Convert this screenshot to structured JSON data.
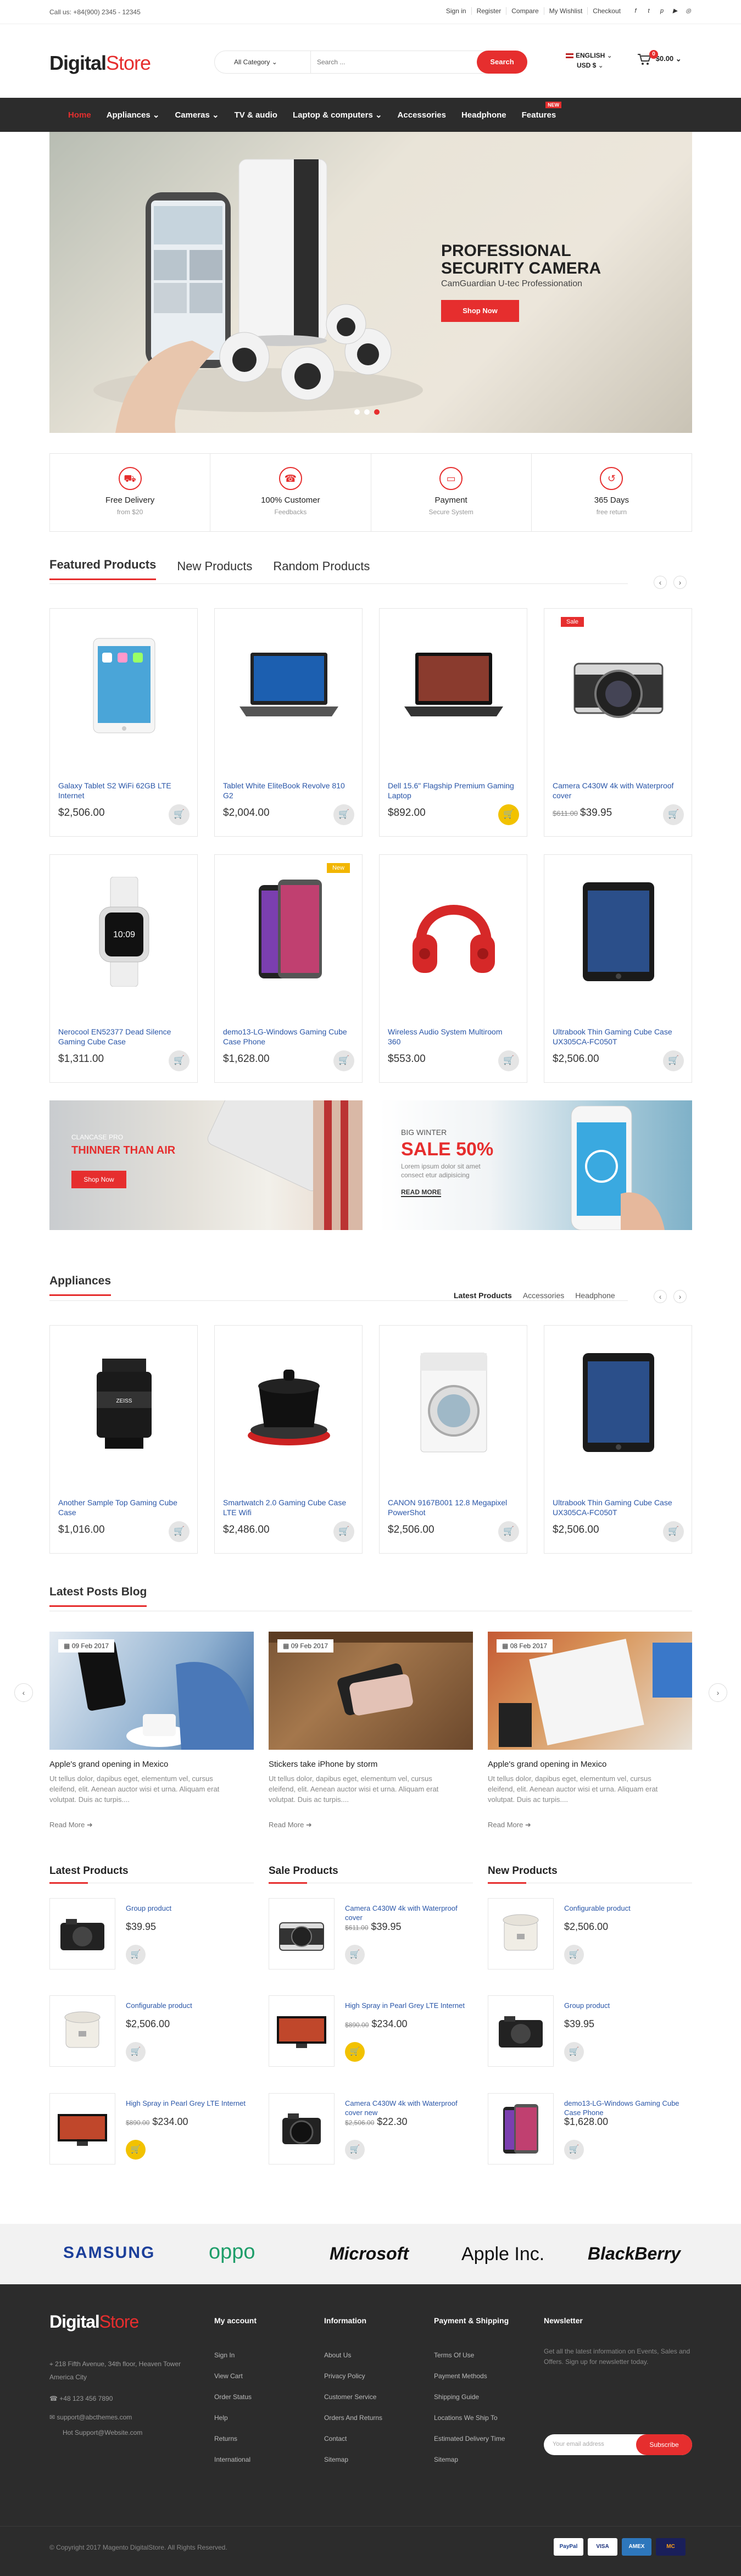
{
  "topbar": {
    "call": "Call us: +84(900) 2345 - 12345",
    "links": [
      "Sign in",
      "Register",
      "Compare",
      "My Wishlist",
      "Checkout"
    ],
    "social": [
      "f",
      "t",
      "p",
      "▶",
      "◎"
    ]
  },
  "header": {
    "logo_main": "Digital",
    "logo_accent": "Store",
    "search_category": "All Category",
    "search_placeholder": "Search ...",
    "search_button": "Search",
    "language": "ENGLISH",
    "currency": "USD $",
    "cart_count": "0",
    "cart_total": "$0.00"
  },
  "nav": {
    "items": [
      "Home",
      "Appliances",
      "Cameras",
      "TV & audio",
      "Laptop & computers",
      "Accessories",
      "Headphone",
      "Features"
    ],
    "new_badge": "NEW"
  },
  "hero": {
    "title": "PROFESSIONAL SECURITY CAMERA",
    "subtitle": "CamGuardian U-tec Professionation",
    "button": "Shop Now"
  },
  "features": [
    {
      "icon": "truck-icon",
      "title": "Free Delivery",
      "sub": "from $20"
    },
    {
      "icon": "support-icon",
      "title": "100% Customer",
      "sub": "Feedbacks"
    },
    {
      "icon": "payment-icon",
      "title": "Payment",
      "sub": "Secure System"
    },
    {
      "icon": "return-icon",
      "title": "365 Days",
      "sub": "free return"
    }
  ],
  "featured": {
    "tabs": [
      "Featured Products",
      "New Products",
      "Random Products"
    ],
    "products": [
      {
        "name": "Galaxy Tablet S2 WiFi 62GB LTE Internet",
        "price": "$2,506.00",
        "old": ""
      },
      {
        "name": "Tablet White EliteBook Revolve 810 G2",
        "price": "$2,004.00",
        "old": ""
      },
      {
        "name": "Dell 15.6\" Flagship Premium Gaming Laptop",
        "price": "$892.00",
        "old": ""
      },
      {
        "name": "Camera C430W 4k with Waterproof cover",
        "price": "$39.95",
        "old": "$611.00"
      },
      {
        "name": "Nerocool EN52377 Dead Silence Gaming Cube Case",
        "price": "$1,311.00",
        "old": ""
      },
      {
        "name": "demo13-LG-Windows Gaming Cube Case Phone",
        "price": "$1,628.00",
        "old": ""
      },
      {
        "name": "Wireless Audio System Multiroom 360",
        "price": "$553.00",
        "old": ""
      },
      {
        "name": "Ultrabook Thin Gaming Cube Case UX305CA-FC050T",
        "price": "$2,506.00",
        "old": ""
      }
    ],
    "sale_label": "Sale",
    "new_label": "New"
  },
  "banners": {
    "b1_small": "CLANCASE PRO",
    "b1_title": "THINNER THAN AIR",
    "b1_button": "Shop Now",
    "b2_small": "BIG WINTER",
    "b2_title": "SALE 50%",
    "b2_text": "Lorem ipsum dolor sit amet consect etur adipisicing",
    "b2_link": "READ MORE"
  },
  "appliances": {
    "title": "Appliances",
    "tabs": [
      "Latest Products",
      "Accessories",
      "Headphone"
    ],
    "products": [
      {
        "name": "Another Sample Top Gaming Cube Case",
        "price": "$1,016.00"
      },
      {
        "name": "Smartwatch 2.0 Gaming Cube Case LTE Wifi",
        "price": "$2,486.00"
      },
      {
        "name": "CANON 9167B001 12.8 Megapixel PowerShot",
        "price": "$2,506.00"
      },
      {
        "name": "Ultrabook Thin Gaming Cube Case UX305CA-FC050T",
        "price": "$2,506.00"
      }
    ]
  },
  "blog": {
    "title": "Latest Posts Blog",
    "read_more": "Read More",
    "posts": [
      {
        "date": "09 Feb 2017",
        "title": "Apple's grand opening in Mexico",
        "body": "Ut tellus dolor, dapibus eget, elementum vel, cursus eleifend, elit. Aenean auctor wisi et urna. Aliquam erat volutpat. Duis ac turpis...."
      },
      {
        "date": "09 Feb 2017",
        "title": "Stickers take iPhone by storm",
        "body": "Ut tellus dolor, dapibus eget, elementum vel, cursus eleifend, elit. Aenean auctor wisi et urna. Aliquam erat volutpat. Duis ac turpis...."
      },
      {
        "date": "08 Feb 2017",
        "title": "Apple's grand opening in Mexico",
        "body": "Ut tellus dolor, dapibus eget, elementum vel, cursus eleifend, elit. Aenean auctor wisi et urna. Aliquam erat volutpat. Duis ac turpis...."
      }
    ]
  },
  "lists": [
    {
      "title": "Latest Products",
      "items": [
        {
          "name": "Group product",
          "price": "$39.95",
          "old": ""
        },
        {
          "name": "Configurable product",
          "price": "$2,506.00",
          "old": ""
        },
        {
          "name": "High Spray in Pearl Grey LTE Internet",
          "price": "$234.00",
          "old": "$890.00"
        }
      ]
    },
    {
      "title": "Sale Products",
      "items": [
        {
          "name": "Camera C430W 4k with Waterproof cover",
          "price": "$39.95",
          "old": "$611.00"
        },
        {
          "name": "High Spray in Pearl Grey LTE Internet",
          "price": "$234.00",
          "old": "$890.00"
        },
        {
          "name": "Camera C430W 4k with Waterproof cover new",
          "price": "$22.30",
          "old": "$2,506.00"
        }
      ]
    },
    {
      "title": "New Products",
      "items": [
        {
          "name": "Configurable product",
          "price": "$2,506.00",
          "old": ""
        },
        {
          "name": "Group product",
          "price": "$39.95",
          "old": ""
        },
        {
          "name": "demo13-LG-Windows Gaming Cube Case Phone",
          "price": "$1,628.00",
          "old": ""
        }
      ]
    }
  ],
  "brands": [
    "SAMSUNG",
    "oppo",
    "Microsoft",
    "Apple Inc.",
    "BlackBerry"
  ],
  "footer": {
    "logo_main": "Digital",
    "logo_accent": "Store",
    "contact": [
      "218 Fifth Avenue, 34th floor, Heaven Tower America City",
      "+48 123 456 7890",
      "support@abcthemes.com",
      "Hot Support@Website.com"
    ],
    "cols": [
      {
        "title": "My account",
        "items": [
          "Sign In",
          "View Cart",
          "Order Status",
          "Help",
          "Returns",
          "International"
        ]
      },
      {
        "title": "Information",
        "items": [
          "About Us",
          "Privacy Policy",
          "Customer Service",
          "Orders And Returns",
          "Contact",
          "Sitemap"
        ]
      },
      {
        "title": "Payment & Shipping",
        "items": [
          "Terms Of Use",
          "Payment Methods",
          "Shipping Guide",
          "Locations We Ship To",
          "Estimated Delivery Time",
          "Sitemap"
        ]
      }
    ],
    "newsletter_title": "Newsletter",
    "newsletter_text": "Get all the latest information on Events, Sales and Offers. Sign up for newsletter today.",
    "newsletter_placeholder": "Your email address",
    "newsletter_button": "Subscribe",
    "copyright": "© Copyright 2017 Magento DigitalStore. All Rights Reserved.",
    "payments": [
      "PayPal",
      "VISA",
      "AMEX",
      "MC"
    ]
  },
  "colors": {
    "accent": "#e62e2e",
    "nav_bg": "#2c2c2c",
    "link": "#2a56a8"
  }
}
